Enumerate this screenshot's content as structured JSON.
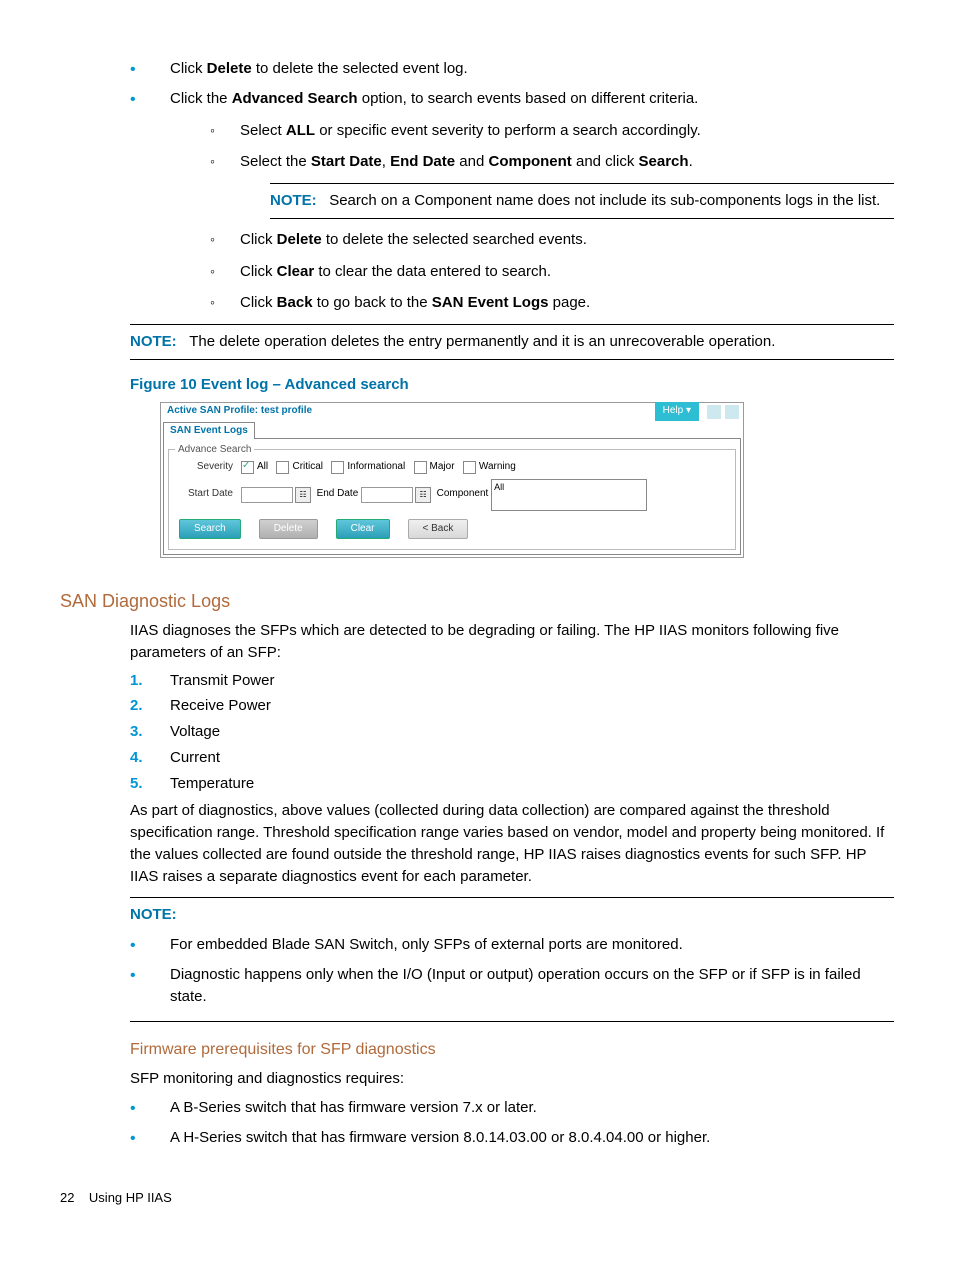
{
  "top_bullets": {
    "b1a": "Click ",
    "b1b": "Delete",
    "b1c": " to delete the selected event log.",
    "b2a": "Click the ",
    "b2b": "Advanced Search",
    "b2c": " option, to search events based on different criteria."
  },
  "sub_circles": {
    "c1a": "Select ",
    "c1b": "ALL",
    "c1c": " or specific event severity to perform a search accordingly.",
    "c2a": "Select the ",
    "c2b": "Start Date",
    "c2c": ", ",
    "c2d": "End Date",
    "c2e": " and ",
    "c2f": "Component",
    "c2g": " and click ",
    "c2h": "Search",
    "c2i": "."
  },
  "note1": {
    "label": "NOTE:",
    "text": "Search on a Component name does not include its sub-components logs in the list."
  },
  "sub_circles2": {
    "d1a": "Click ",
    "d1b": "Delete",
    "d1c": " to delete the selected searched events.",
    "d2a": "Click ",
    "d2b": "Clear",
    "d2c": " to clear the data entered to search.",
    "d3a": "Click ",
    "d3b": "Back",
    "d3c": " to go back to the ",
    "d3d": "SAN Event Logs",
    "d3e": " page."
  },
  "note2": {
    "label": "NOTE:",
    "text": "The delete operation deletes the entry permanently and it is an unrecoverable operation."
  },
  "figure_title": "Figure 10 Event log – Advanced search",
  "shot": {
    "profile_label": "Active SAN Profile:   test profile",
    "help": "Help ▾",
    "tab": "SAN Event Logs",
    "fs_legend": "Advance Search",
    "severity_label": "Severity",
    "sev": {
      "all": "All",
      "critical": "Critical",
      "info": "Informational",
      "major": "Major",
      "warn": "Warning"
    },
    "start_label": "Start Date",
    "end_label": "End Date",
    "comp_label": "Component",
    "comp_val": "All",
    "btns": {
      "search": "Search",
      "delete": "Delete",
      "clear": "Clear",
      "back": "< Back"
    }
  },
  "h2": "SAN Diagnostic Logs",
  "p_diag": "IIAS diagnoses the SFPs which are detected to be degrading or failing. The HP IIAS monitors following five parameters of an SFP:",
  "params": [
    "Transmit Power",
    "Receive Power",
    "Voltage",
    "Current",
    "Temperature"
  ],
  "p_diag2": "As part of diagnostics, above values (collected during data collection) are compared against the threshold specification range. Threshold specification range varies based on vendor, model and property being monitored. If the values collected are found outside the threshold range, HP IIAS raises diagnostics events for such SFP. HP IIAS raises a separate diagnostics event for each parameter.",
  "note3": {
    "label": "NOTE:",
    "b1": "For embedded Blade SAN Switch, only SFPs of external ports are monitored.",
    "b2": "Diagnostic happens only when the I/O (Input or output) operation occurs on the SFP or if SFP is in failed state."
  },
  "h3": "Firmware prerequisites for SFP diagnostics",
  "p_fw": "SFP monitoring and diagnostics requires:",
  "fw_bullets": {
    "b1": "A B-Series switch that has firmware version 7.x or later.",
    "b2": "A H-Series switch that has firmware version 8.0.14.03.00 or 8.0.4.04.00 or higher."
  },
  "footer": {
    "page": "22",
    "title": "Using HP IIAS"
  }
}
